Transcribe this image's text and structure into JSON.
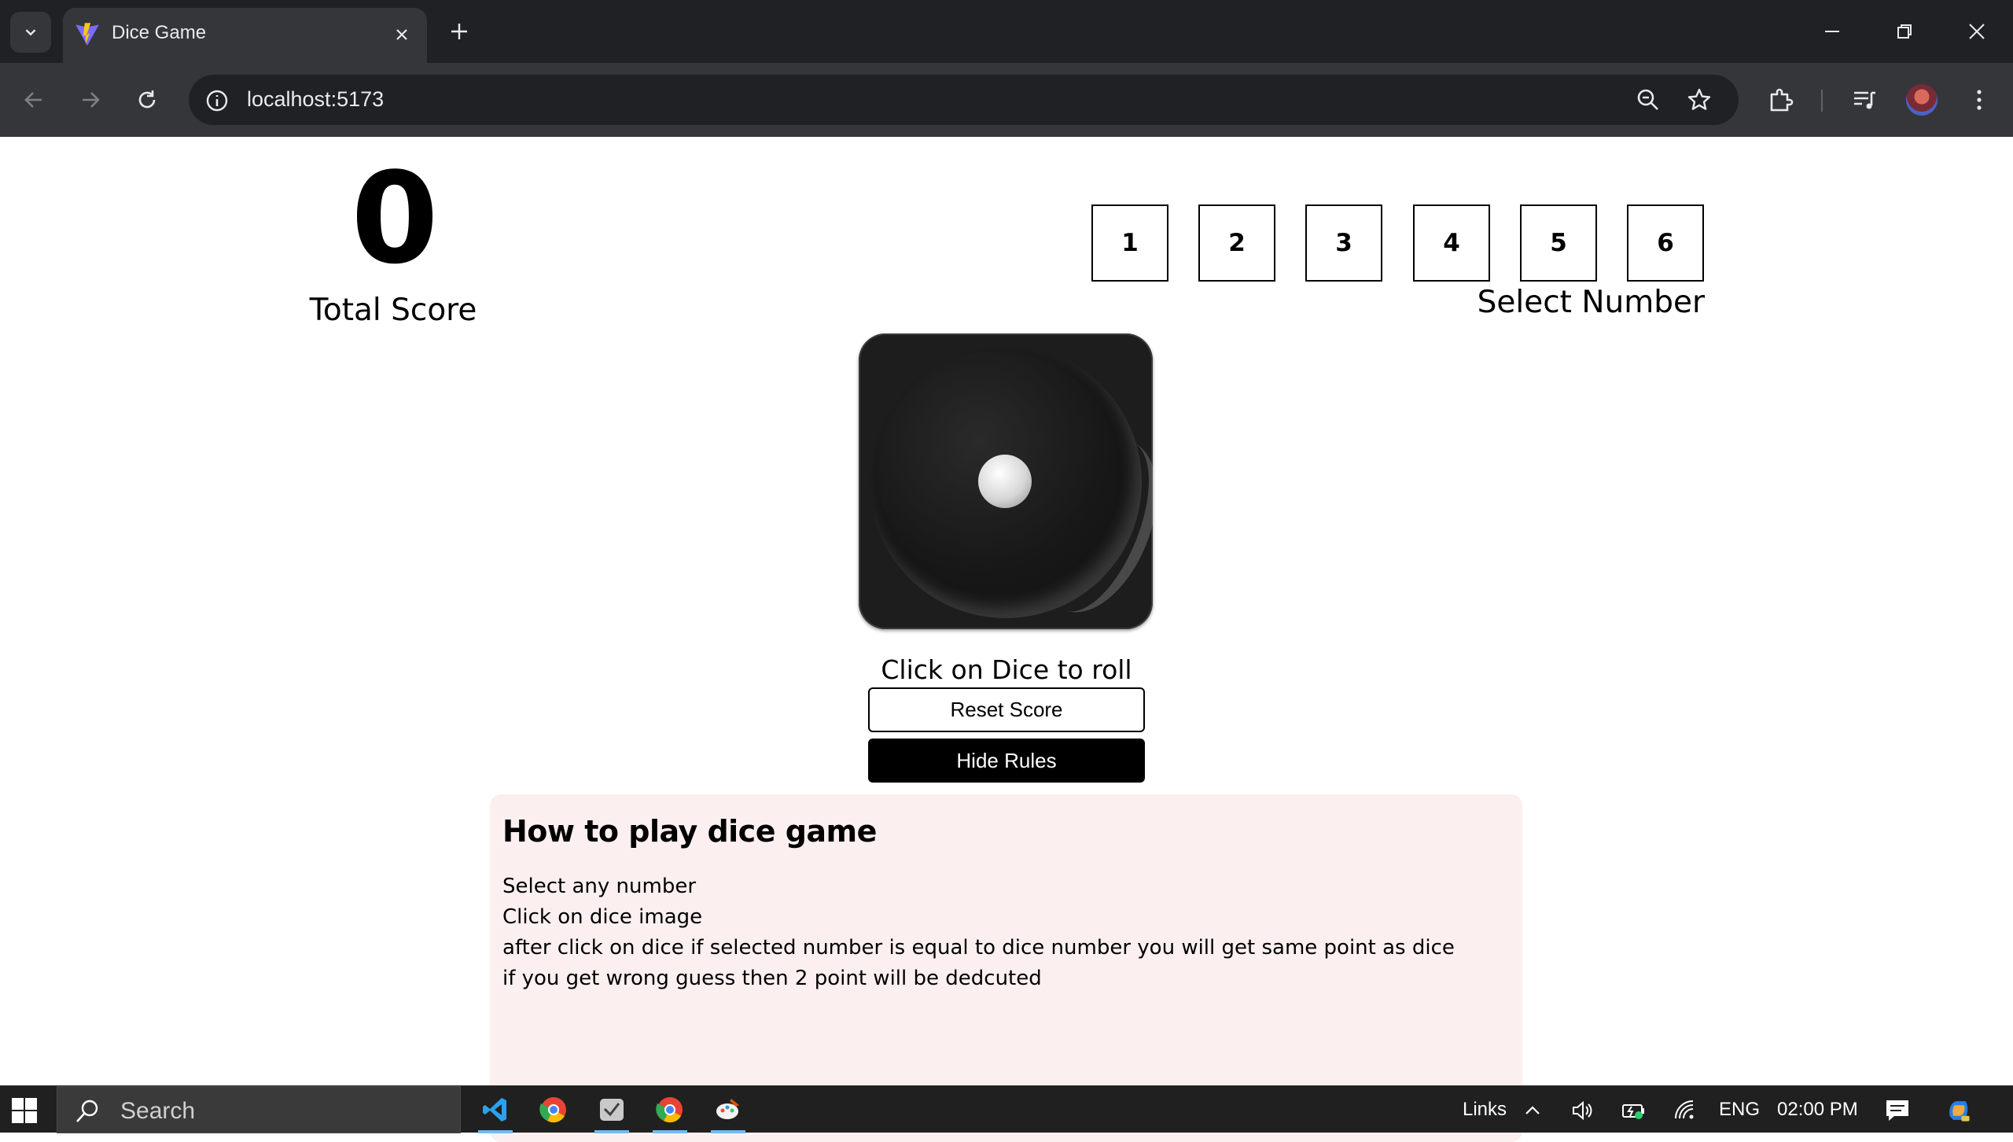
{
  "browser": {
    "tab_title": "Dice Game",
    "url": "localhost:5173"
  },
  "game": {
    "total_score": "0",
    "total_score_label": "Total Score",
    "numbers": [
      "1",
      "2",
      "3",
      "4",
      "5",
      "6"
    ],
    "select_number_label": "Select Number",
    "dice_value": 1,
    "roll_hint": "Click on Dice to roll",
    "reset_label": "Reset Score",
    "hide_rules_label": "Hide Rules"
  },
  "rules": {
    "title": "How to play dice game",
    "lines": [
      "Select any number",
      "Click on dice image",
      "after click on dice if selected number is equal to dice number you will get same point as dice",
      "if you get wrong guess then 2 point will be dedcuted"
    ]
  },
  "taskbar": {
    "search_placeholder": "Search",
    "links_label": "Links",
    "language": "ENG",
    "time": "02:00 PM"
  },
  "colors": {
    "chrome_dark": "#202124",
    "chrome_toolbar": "#35363a",
    "rules_bg": "#fbf0ef",
    "button_dark": "#000000",
    "taskbar_bg": "#202020"
  }
}
